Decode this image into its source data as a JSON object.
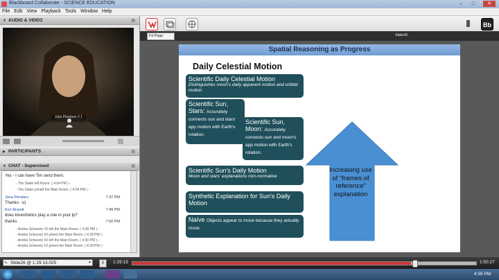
{
  "window": {
    "title": "Blackboard Collaborate - SCIENCE EDUCATION",
    "controls": [
      "–",
      "□",
      "✕"
    ]
  },
  "menubar": [
    "File",
    "Edit",
    "View",
    "Playback",
    "Tools",
    "Window",
    "Help"
  ],
  "left_panel": {
    "audio_video_label": "AUDIO & VIDEO",
    "participants_label": "PARTICIPANTS",
    "chat_label": "CHAT - Supervised",
    "video_caption": "Julia Plummer # 1"
  },
  "chat": [
    {
      "type": "msg",
      "text": "Yes - I can have Tim send them."
    },
    {
      "type": "sys",
      "text": "- Tim Slater left Room. ( 4:04 PM ) -"
    },
    {
      "type": "sys",
      "text": "- Tim Slater joined the Main Room. ( 4:04 PM ) -"
    },
    {
      "type": "name",
      "text": "Jana Pendars",
      "time": "7:37 PM"
    },
    {
      "type": "msg",
      "text": "Thanks- :o)"
    },
    {
      "type": "name",
      "text": "Ken Brandt",
      "time": "7:49 PM"
    },
    {
      "type": "msg",
      "text": "does kinesthetics play a role in your lp?"
    },
    {
      "type": "msg",
      "text": "thanks",
      "time": "7:50 PM"
    },
    {
      "type": "sys",
      "text": "- Andria Schwortz #2 left the Main Room. ( 4:28 PM ) -"
    },
    {
      "type": "sys",
      "text": "- Andria Schwortz #2 joined the Main Room. ( 4:28 PM ) -"
    },
    {
      "type": "sys",
      "text": "- Andria Schwortz #2 left the Main Room. ( 4:30 PM ) -"
    },
    {
      "type": "sys",
      "text": "- Andria Schwortz #2 joined the Main Room. ( 4:30 PM ) -"
    }
  ],
  "toolbar": {
    "fit_page": "Fit Page",
    "slide_label": "Slide26"
  },
  "slide": {
    "header": "Spatial Reasoning as Progress",
    "title": "Daily Celestial Motion",
    "box1_title": "Scientific Daily Celestial Motion",
    "box1_sub": "Distinguishes moon's daily apparent motion and orbital motion",
    "box2_title": "Scientific Sun, Stars:",
    "box2_sub": "Accurately connects sun and stars' app motion with Earth's rotation.",
    "box3_title": "Scientific Sun, Moon:",
    "box3_sub": "Accurately connects sun and moon's app motion with Earth's rotation.",
    "box4_title": "Scientific Sun's Daily Motion",
    "box4_sub": "Moon and stars' explanations non-normative",
    "box5_title": "Synthetic Explanation for Sun's Daily Motion",
    "box6_title": "Naïve",
    "box6_sub": "Objects appear to move because they actually move",
    "arrow_text": "Increasing use of “frames of reference” explanation"
  },
  "playback": {
    "slide_select": "Slide26 @ 1:29:13.025",
    "current_time": "1:29:13",
    "total_time": "1:50:27",
    "progress": 0.81,
    "knob": 0.82
  },
  "taskbar": {
    "clock": "4:39 PM"
  }
}
